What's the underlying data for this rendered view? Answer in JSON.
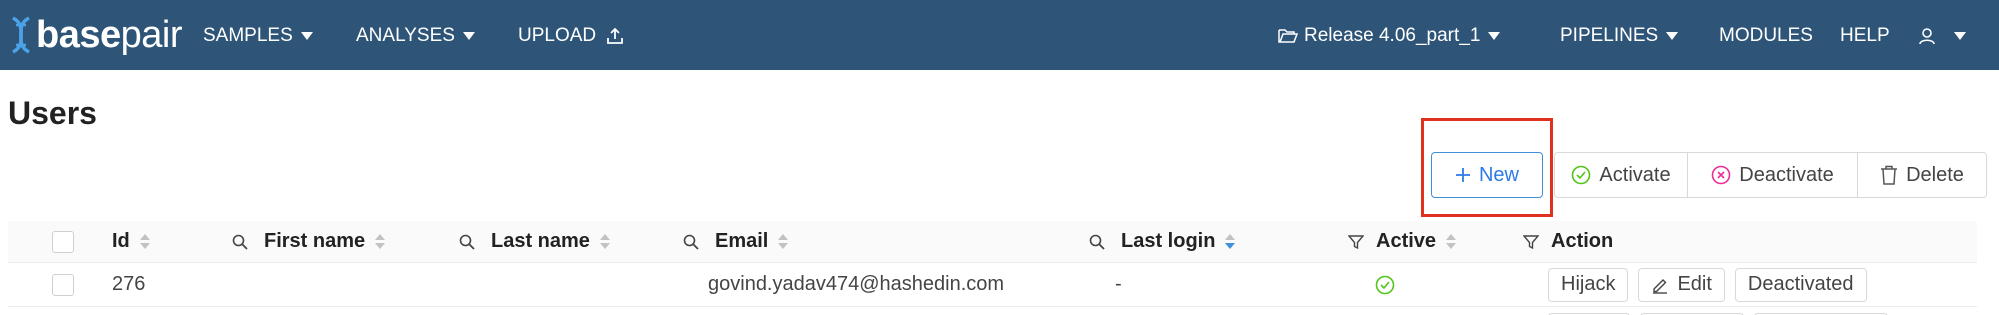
{
  "app": {
    "brand_bold": "base",
    "brand_light": "pair",
    "nav_left": [
      {
        "label": "SAMPLES",
        "icon": "caret-down-icon"
      },
      {
        "label": "ANALYSES",
        "icon": "caret-down-icon"
      },
      {
        "label": "UPLOAD",
        "icon": "upload-icon"
      }
    ],
    "nav_right": {
      "release": "Release 4.06_part_1",
      "pipelines": "PIPELINES",
      "modules": "MODULES",
      "help": "HELP"
    },
    "colors": {
      "navbar": "#2e5578",
      "accent": "#2c7be5",
      "success": "#52c41a",
      "danger": "#eb2f96",
      "highlight": "#e0301e"
    }
  },
  "page": {
    "title": "Users"
  },
  "toolbar": {
    "new_label": "New",
    "activate_label": "Activate",
    "deactivate_label": "Deactivate",
    "delete_label": "Delete"
  },
  "table": {
    "columns": {
      "id": "Id",
      "first_name": "First name",
      "last_name": "Last name",
      "email": "Email",
      "last_login": "Last login",
      "active": "Active",
      "action": "Action"
    },
    "rows": [
      {
        "id": "276",
        "first_name": "",
        "last_name": "",
        "email": "govind.yadav474@hashedin.com",
        "last_login": "-",
        "active_icon": "check-circle-icon",
        "actions": {
          "hijack": "Hijack",
          "edit": "Edit",
          "status": "Deactivated"
        }
      }
    ]
  }
}
